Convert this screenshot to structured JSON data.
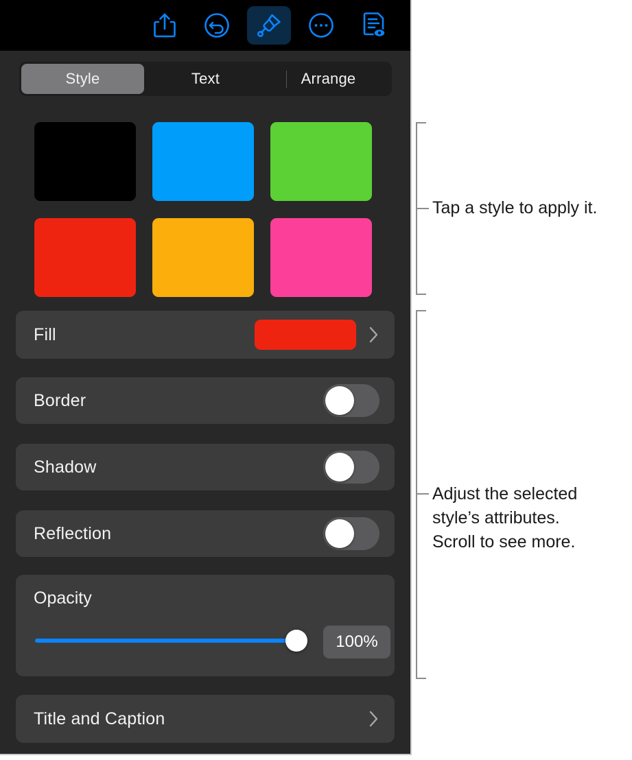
{
  "app": {
    "panel_background": "#282828",
    "row_background": "#3c3c3c",
    "accent": "#0a84ff"
  },
  "toolbar": {
    "items": [
      {
        "name": "share-icon",
        "label": "Share",
        "selected": false
      },
      {
        "name": "undo-icon",
        "label": "Undo",
        "selected": false
      },
      {
        "name": "brush-icon",
        "label": "Format",
        "selected": true
      },
      {
        "name": "more-icon",
        "label": "More",
        "selected": false
      },
      {
        "name": "document-view-icon",
        "label": "Document View",
        "selected": false
      }
    ],
    "selected_highlight": "#0a2a46",
    "icon_color": "#0a84ff"
  },
  "tabs": {
    "items": [
      {
        "label": "Style",
        "selected": true
      },
      {
        "label": "Text",
        "selected": false
      },
      {
        "label": "Arrange",
        "selected": false
      }
    ],
    "selected_pill_color": "#7a7a7d"
  },
  "styles": {
    "swatches": [
      {
        "name": "style-swatch-black",
        "color": "#000000"
      },
      {
        "name": "style-swatch-blue",
        "color": "#009dfb"
      },
      {
        "name": "style-swatch-green",
        "color": "#5bd135"
      },
      {
        "name": "style-swatch-red",
        "color": "#ee2410"
      },
      {
        "name": "style-swatch-orange",
        "color": "#fbae0c"
      },
      {
        "name": "style-swatch-pink",
        "color": "#fc4099"
      }
    ]
  },
  "controls": {
    "fill": {
      "label": "Fill",
      "color": "#ee2410",
      "chevron": "chevron-right-icon"
    },
    "border": {
      "label": "Border",
      "on": false
    },
    "shadow": {
      "label": "Shadow",
      "on": false
    },
    "reflection": {
      "label": "Reflection",
      "on": false
    },
    "opacity": {
      "label": "Opacity",
      "value": "100%",
      "percent": 100
    },
    "title_and_caption": {
      "label": "Title and Caption",
      "chevron": "chevron-right-icon"
    }
  },
  "annotations": [
    {
      "name": "callout-styles",
      "text": "Tap a style to apply it."
    },
    {
      "name": "callout-attributes",
      "text": "Adjust the selected\nstyle’s attributes.\nScroll to see more."
    }
  ]
}
